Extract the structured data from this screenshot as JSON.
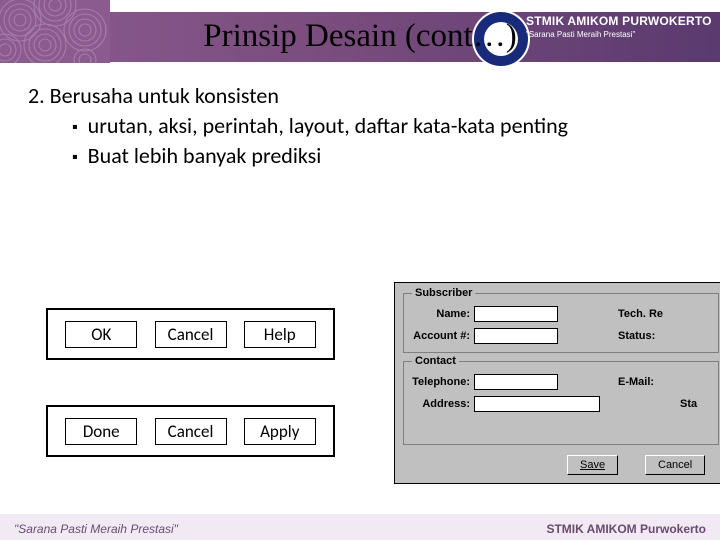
{
  "header": {
    "title": "Prinsip Desain (cont…)",
    "brand_line1": "STMIK AMIKOM PURWOKERTO",
    "brand_line2": "\"Sarana Pasti Meraih Prestasi\""
  },
  "body": {
    "heading": "2. Berusaha untuk konsisten",
    "bullets": [
      "urutan, aksi, perintah, layout, daftar kata-kata penting",
      "Buat lebih banyak prediksi"
    ]
  },
  "button_row_1": {
    "b1": "OK",
    "b2": "Cancel",
    "b3": "Help"
  },
  "button_row_2": {
    "b1": "Done",
    "b2": "Cancel",
    "b3": "Apply"
  },
  "form": {
    "group1": "Subscriber",
    "group2": "Contact",
    "name_lbl": "Name:",
    "acct_lbl": "Account #:",
    "tech_lbl": "Tech. Re",
    "status_lbl": "Status:",
    "tel_lbl": "Telephone:",
    "addr_lbl": "Address:",
    "email_lbl": "E-Mail:",
    "sta_lbl": "Sta",
    "save": "Save",
    "cancel": "Cancel"
  },
  "footer": {
    "quote": "\"Sarana Pasti Meraih Prestasi\"",
    "brand": "STMIK AMIKOM Purwokerto"
  }
}
